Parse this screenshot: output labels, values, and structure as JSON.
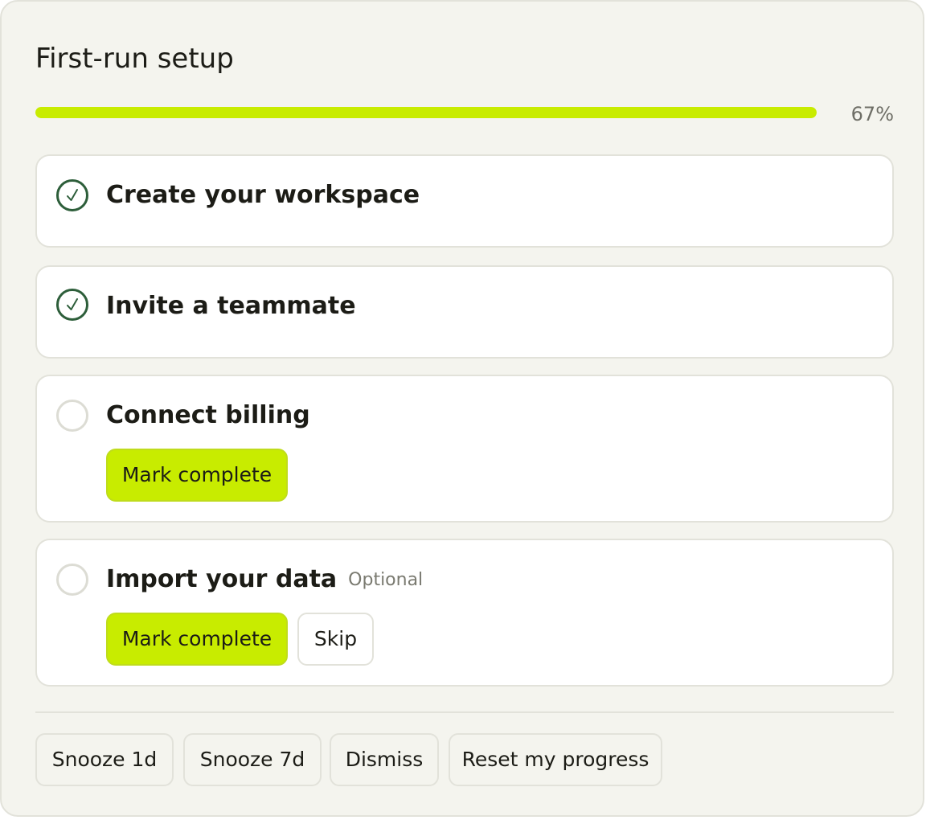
{
  "title": "First-run setup",
  "progress": {
    "percent": 67,
    "label": "67%",
    "fill_color": "#c8ec00"
  },
  "steps": [
    {
      "title": "Create your workspace",
      "status": "complete",
      "icon": "check-circle-icon"
    },
    {
      "title": "Invite a teammate",
      "status": "complete",
      "icon": "check-circle-icon"
    },
    {
      "title": "Connect billing",
      "status": "incomplete",
      "icon": "empty-circle-icon",
      "actions": {
        "mark_complete": "Mark complete"
      }
    },
    {
      "title": "Import your data",
      "status": "incomplete",
      "icon": "empty-circle-icon",
      "tag": "Optional",
      "actions": {
        "mark_complete": "Mark complete",
        "skip": "Skip"
      }
    }
  ],
  "footer": {
    "snooze_1d": "Snooze 1d",
    "snooze_7d": "Snooze 7d",
    "dismiss": "Dismiss",
    "reset": "Reset my progress"
  },
  "colors": {
    "accent": "#c8ec00",
    "check": "#2d5e3a",
    "background": "#f4f4ee"
  }
}
